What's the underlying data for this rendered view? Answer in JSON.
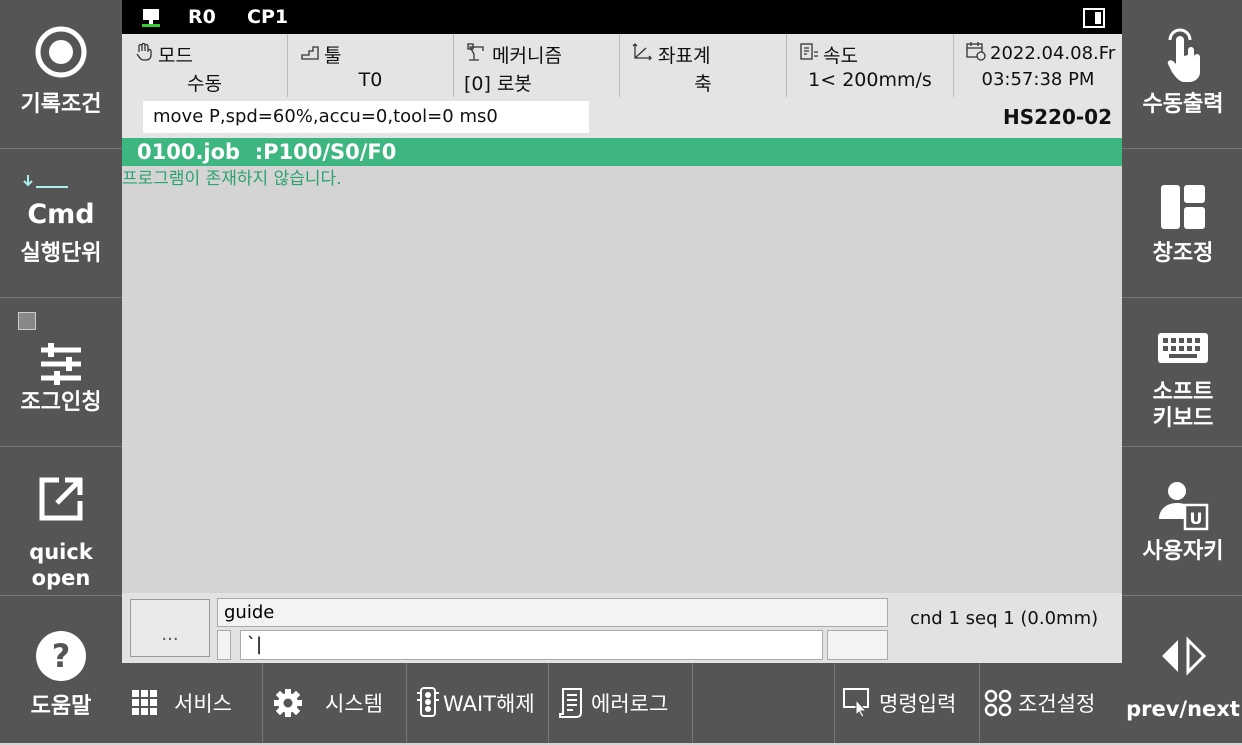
{
  "top_bar": {
    "robot": "R0",
    "program": "CP1"
  },
  "status": {
    "mode": {
      "label": "모드",
      "value": "수동"
    },
    "tool": {
      "label": "툴",
      "value": "T0"
    },
    "mechanism": {
      "label": "메커니즘",
      "value": "[0] 로봇"
    },
    "coordinate": {
      "label": "좌표계",
      "value": "축"
    },
    "speed": {
      "label": "속도",
      "value": "1< 200mm/s"
    },
    "datetime": {
      "date": "2022.04.08.Fr",
      "time": "03:57:38 PM"
    }
  },
  "command_line": "move P,spd=60%,accu=0,tool=0 ms0",
  "model": "HS220-02",
  "job_bar": "0100.job  :P100/S0/F0",
  "message": "프로그램이 존재하지 않습니다.",
  "left_sidebar": [
    {
      "label": "기록조건",
      "icon": "record-icon"
    },
    {
      "label": "실행단위",
      "sub": "Cmd",
      "icon": "cmd-icon"
    },
    {
      "label": "조그인칭",
      "icon": "sliders-icon"
    },
    {
      "label": "quick open",
      "icon": "external-link-icon"
    },
    {
      "label": "도움말",
      "icon": "help-icon"
    }
  ],
  "right_sidebar": [
    {
      "label": "수동출력",
      "icon": "touch-icon"
    },
    {
      "label": "창조정",
      "icon": "window-layout-icon"
    },
    {
      "label": "소프트",
      "label2": "키보드",
      "icon": "keyboard-icon"
    },
    {
      "label": "사용자키",
      "icon": "user-key-icon"
    },
    {
      "label": "prev/next",
      "icon": "prev-next-icon"
    }
  ],
  "bottom": {
    "dots": "...",
    "guide": "guide",
    "input_value": "`|",
    "cnd": "cnd 1 seq 1 (0.0mm)"
  },
  "tabs": [
    {
      "label": "서비스",
      "icon": "grid-icon"
    },
    {
      "label": "시스템",
      "icon": "gear-icon"
    },
    {
      "label": "WAIT해제",
      "icon": "traffic-light-icon"
    },
    {
      "label": "에러로그",
      "icon": "log-icon"
    },
    {
      "label": "명령입력",
      "icon": "command-input-icon"
    },
    {
      "label": "조건설정",
      "icon": "condition-icon"
    }
  ]
}
